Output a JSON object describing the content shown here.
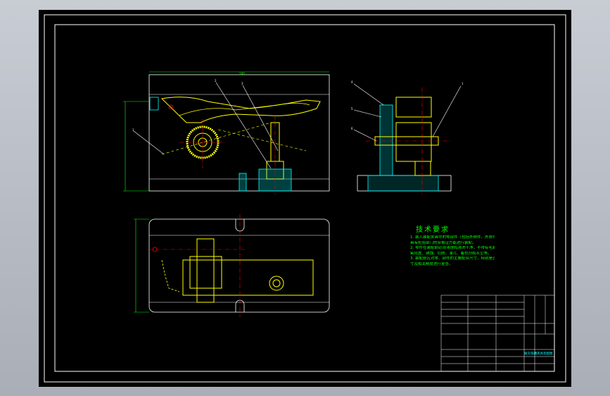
{
  "drawing": {
    "background_color": "#000000",
    "frame_color": "#ffffff",
    "part_color": "#ffff00",
    "dimension_color": "#00ff00",
    "centerline_color": "#ff0000",
    "section_color": "#00ffff",
    "leader_color": "#ffffff"
  },
  "views": [
    {
      "name": "front-view",
      "balloons": [
        "1",
        "2",
        "3"
      ]
    },
    {
      "name": "side-view",
      "balloons": [
        "4",
        "5",
        "6",
        "7"
      ]
    },
    {
      "name": "top-view",
      "balloons": []
    }
  ],
  "technical_requirements": {
    "title": "技术要求",
    "lines": [
      "1. 装入装配夹具中的零部件（包括外购件、外协件），均必须",
      "具有检验部门的合格证方能进行装配。",
      "2. 零件在装配前必须清理和清洗干净，不得有毛刺、飞边、",
      "氧化皮、锈蚀、切屑、油污、着色剂和灰尘等。",
      "3. 装配前应对零、部件的主要配合尺寸，特别是过盈配合尺",
      "寸及相关精度进行复查。"
    ]
  },
  "title_block": {
    "drawing_title": "拨叉铣槽夹具装配图"
  }
}
